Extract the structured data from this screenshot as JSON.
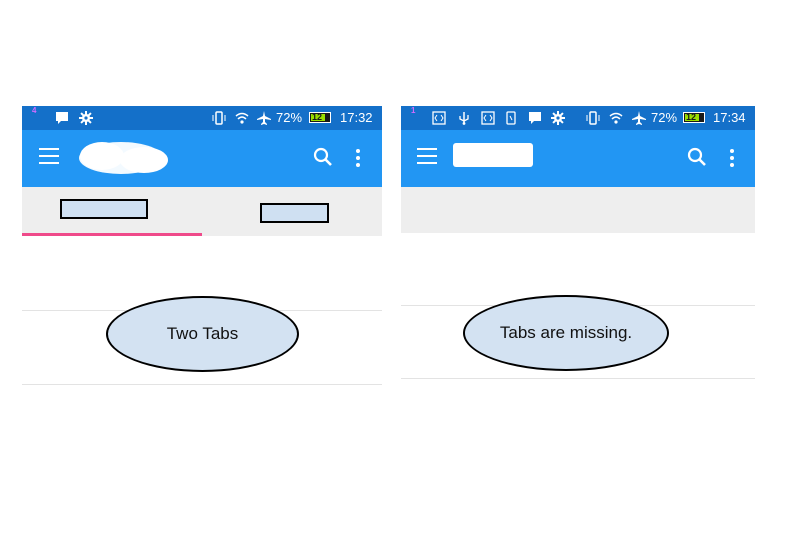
{
  "left_screen": {
    "status_bar": {
      "notification_count": "4",
      "battery_percent": "72%",
      "battery_level": "12",
      "time": "17:32"
    },
    "app_bar": {
      "menu_icon": "hamburger-menu-icon",
      "search_icon": "search-icon",
      "more_icon": "more-vert-icon"
    },
    "tabs": {
      "count": 2,
      "selected_index": 0
    },
    "callout": "Two Tabs"
  },
  "right_screen": {
    "status_bar": {
      "notification_count": "1",
      "battery_percent": "72%",
      "battery_level": "12",
      "time": "17:34"
    },
    "app_bar": {
      "menu_icon": "hamburger-menu-icon",
      "search_icon": "search-icon",
      "more_icon": "more-vert-icon"
    },
    "callout": "Tabs are missing."
  },
  "colors": {
    "status_bar": "#1470c9",
    "app_bar": "#2296f3",
    "tab_indicator": "#ef4a8a",
    "tab_background": "#eeeeee",
    "callout_fill": "#d3e2f2"
  }
}
